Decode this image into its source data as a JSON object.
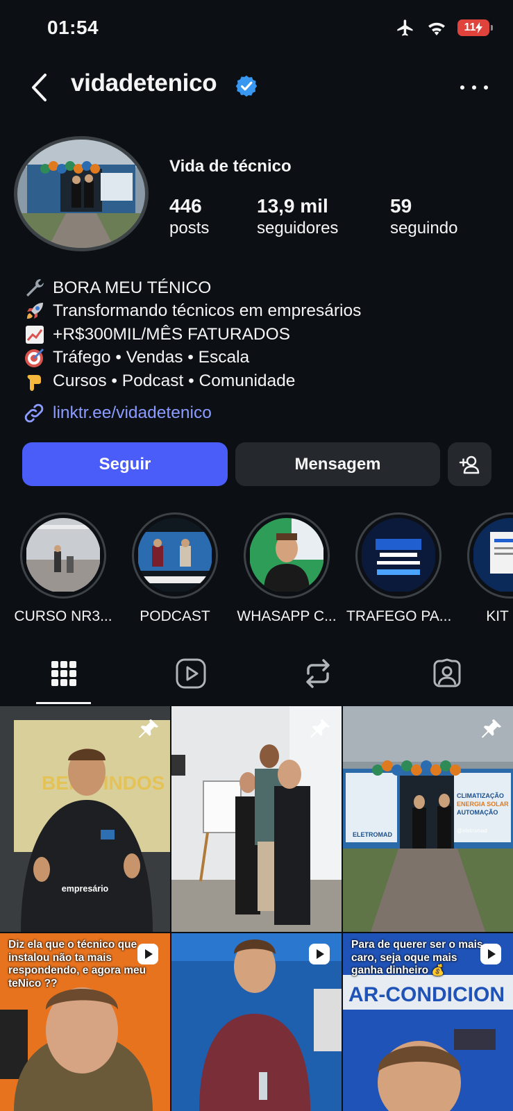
{
  "status_bar": {
    "time": "01:54",
    "battery": "11"
  },
  "header": {
    "username": "vidadetenico"
  },
  "profile": {
    "display_name": "Vida de técnico",
    "stats": [
      {
        "value": "446",
        "label": "posts"
      },
      {
        "value": "13,9 mil",
        "label": "seguidores"
      },
      {
        "value": "59",
        "label": "seguindo"
      }
    ],
    "bio": [
      {
        "icon": "wrench-icon",
        "text": "BORA MEU TÉNICO"
      },
      {
        "icon": "rocket-icon",
        "text": "Transformando técnicos em empresários"
      },
      {
        "icon": "chart-up-icon",
        "text": "+R$300MIL/MÊS FATURADOS"
      },
      {
        "icon": "target-icon",
        "text": "Tráfego • Vendas • Escala"
      },
      {
        "icon": "pointing-down-icon",
        "text": "Cursos • Podcast • Comunidade"
      }
    ],
    "link": "linktr.ee/vidadetenico"
  },
  "actions": {
    "follow": "Seguir",
    "message": "Mensagem"
  },
  "highlights": [
    {
      "label": "CURSO NR3..."
    },
    {
      "label": "PODCAST"
    },
    {
      "label": "WHASAPP C..."
    },
    {
      "label": "TRAFEGO PA..."
    },
    {
      "label": "KIT PM"
    }
  ],
  "tabs": [
    "posts-grid-icon",
    "reels-icon",
    "reposts-icon",
    "tagged-icon"
  ],
  "posts": [
    {
      "type": "pinned",
      "subtitle": "empresário",
      "bg_text": "BEM VINDOS"
    },
    {
      "type": "pinned"
    },
    {
      "type": "pinned",
      "store_lines": [
        "CLIMATIZAÇÃO",
        "ENERGIA SOLAR",
        "AUTOMAÇÃO"
      ],
      "store_name": "ELETROMAD",
      "handle": "@eletromad"
    },
    {
      "type": "reel",
      "caption": "Diz ela que o técnico que instalou não ta mais respondendo, e agora meu teNico ??"
    },
    {
      "type": "reel"
    },
    {
      "type": "reel",
      "caption": "Para de querer ser o mais caro, seja oque mais ganha dinheiro 💰",
      "bg_text": "AR-CONDICION"
    }
  ],
  "colors": {
    "background": "#0c1014",
    "follow_button": "#4a5df9",
    "secondary_button": "#25292e",
    "link": "#8b9bff",
    "verified": "#3897f0"
  }
}
